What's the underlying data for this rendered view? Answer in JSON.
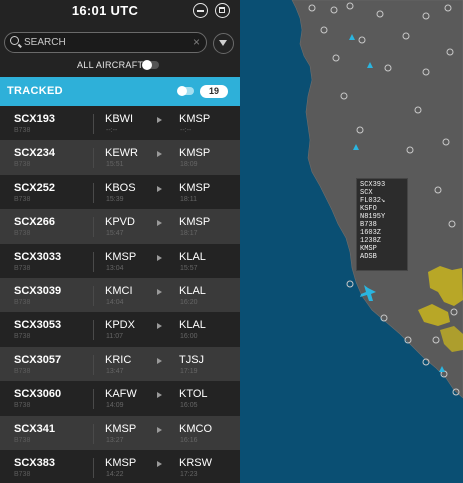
{
  "header": {
    "time": "16:01 UTC"
  },
  "search": {
    "placeholder": "SEARCH",
    "clear_icon": "close-icon",
    "filter_icon": "filter-icon"
  },
  "all_aircraft": {
    "label": "ALL AIRCRAFT",
    "enabled": false
  },
  "tracked": {
    "label": "TRACKED",
    "enabled": true,
    "count": "19"
  },
  "flights": [
    {
      "callsign": "SCX193",
      "type": "B738",
      "origin": "KBWI",
      "origin_time": "--:--",
      "dest": "KMSP",
      "dest_time": "--:--"
    },
    {
      "callsign": "SCX234",
      "type": "B738",
      "origin": "KEWR",
      "origin_time": "15:51",
      "dest": "KMSP",
      "dest_time": "18:09"
    },
    {
      "callsign": "SCX252",
      "type": "B738",
      "origin": "KBOS",
      "origin_time": "15:39",
      "dest": "KMSP",
      "dest_time": "18:11"
    },
    {
      "callsign": "SCX266",
      "type": "B738",
      "origin": "KPVD",
      "origin_time": "15:47",
      "dest": "KMSP",
      "dest_time": "18:17"
    },
    {
      "callsign": "SCX3033",
      "type": "B738",
      "origin": "KMSP",
      "origin_time": "13:04",
      "dest": "KLAL",
      "dest_time": "15:57"
    },
    {
      "callsign": "SCX3039",
      "type": "B738",
      "origin": "KMCI",
      "origin_time": "14:04",
      "dest": "KLAL",
      "dest_time": "16:20"
    },
    {
      "callsign": "SCX3053",
      "type": "B738",
      "origin": "KPDX",
      "origin_time": "11:07",
      "dest": "KLAL",
      "dest_time": "16:00"
    },
    {
      "callsign": "SCX3057",
      "type": "B738",
      "origin": "KRIC",
      "origin_time": "13:47",
      "dest": "TJSJ",
      "dest_time": "17:19"
    },
    {
      "callsign": "SCX3060",
      "type": "B738",
      "origin": "KAFW",
      "origin_time": "14:09",
      "dest": "KTOL",
      "dest_time": "16:05"
    },
    {
      "callsign": "SCX341",
      "type": "B738",
      "origin": "KMSP",
      "origin_time": "13:27",
      "dest": "KMCO",
      "dest_time": "16:16"
    },
    {
      "callsign": "SCX383",
      "type": "B738",
      "origin": "KMSP",
      "origin_time": "14:22",
      "dest": "KRSW",
      "dest_time": "17:23"
    }
  ],
  "popup": {
    "lines": [
      "SCX393",
      "SCX",
      "FL032↘",
      "KSFO",
      "N8195Y",
      "B738",
      "1603Z",
      "1238Z",
      "KMSP",
      "ADSB"
    ]
  },
  "colors": {
    "accent": "#2eb0d9",
    "sidebar": "#232323",
    "ocean": "#0a4f73",
    "land": "#5a5a5a",
    "weather": "#c9b51f",
    "aircraft": "#2ab5e0"
  }
}
